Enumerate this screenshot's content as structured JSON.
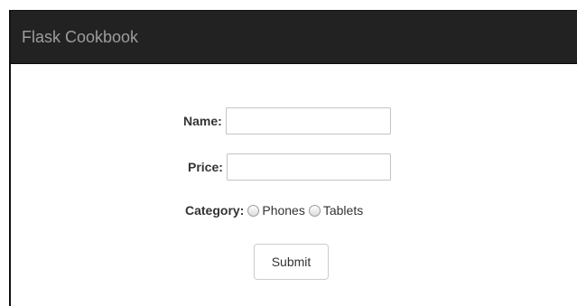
{
  "navbar": {
    "brand": "Flask Cookbook"
  },
  "form": {
    "name": {
      "label": "Name:",
      "value": ""
    },
    "price": {
      "label": "Price:",
      "value": ""
    },
    "category": {
      "label": "Category:",
      "options": [
        "Phones",
        "Tablets"
      ],
      "selected": null
    },
    "submit_label": "Submit"
  },
  "colors": {
    "navbar_bg": "#222222",
    "brand_text": "#9d9d9d",
    "page_bg": "#ffffff",
    "text": "#333333"
  }
}
